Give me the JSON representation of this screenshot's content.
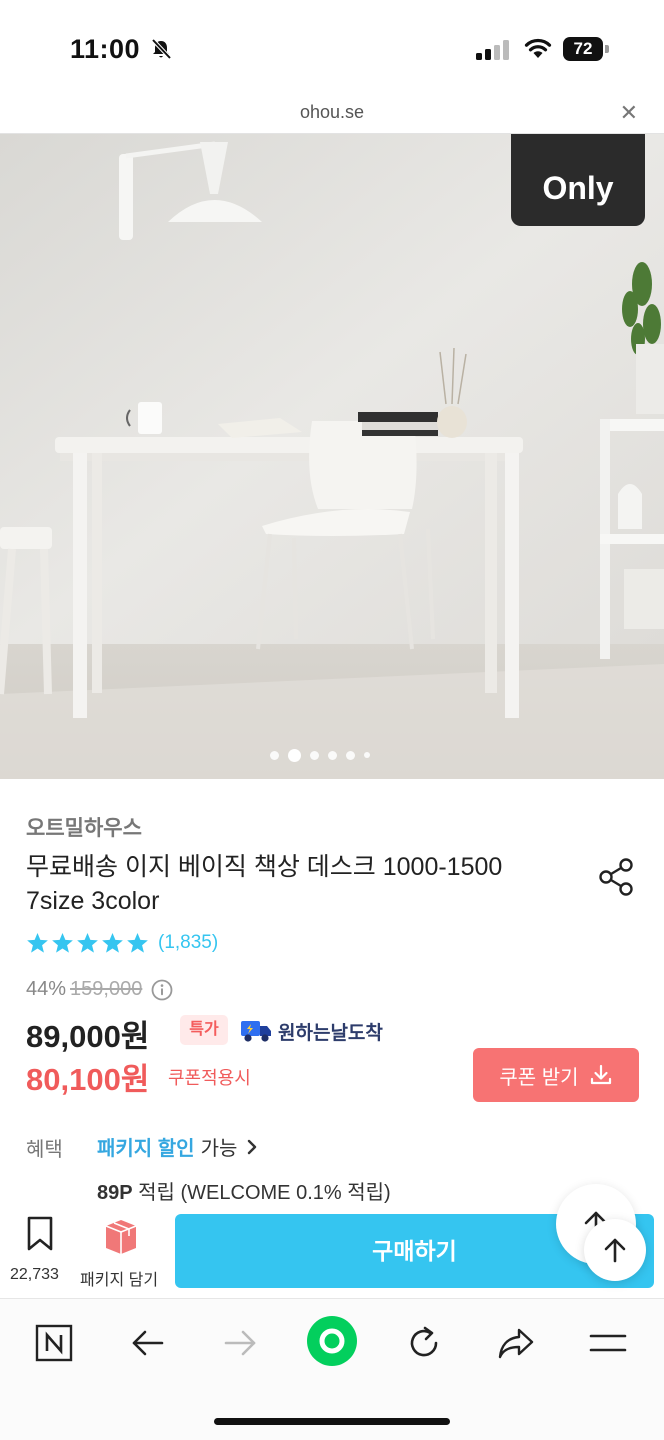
{
  "status_bar": {
    "time": "11:00",
    "battery": "72"
  },
  "url_bar": {
    "domain": "ohou.se",
    "close_icon": "close-icon"
  },
  "hero": {
    "badge": "Only",
    "image_count": 7,
    "active_index": 1
  },
  "product": {
    "brand": "오트밀하우스",
    "title": "무료배송 이지 베이직 책상 데스크 1000-1500 7size 3color",
    "rating_stars": 5,
    "review_count": "(1,835)",
    "discount": "44%",
    "original_price": "159,000",
    "price": "89,000원",
    "special_badge": "특가",
    "delivery_label": "원하는날도착",
    "coupon_price": "80,100원",
    "coupon_price_label": "쿠폰적용시",
    "coupon_button": "쿠폰 받기"
  },
  "benefit": {
    "label": "혜택",
    "package_link": "패키지 할인",
    "package_suffix": "가능",
    "points_amount": "89P",
    "points_text": "적립 (WELCOME 0.1% 적립)"
  },
  "buy_bar": {
    "bookmark_count": "22,733",
    "package_label": "패키지 담기",
    "buy_button": "구매하기"
  },
  "colors": {
    "accent": "#35c5f0",
    "coupon_red": "#f05b5b",
    "coupon_button": "#f77373",
    "delivery_navy": "#2d3c6b",
    "naver_green": "#03cf5d"
  }
}
